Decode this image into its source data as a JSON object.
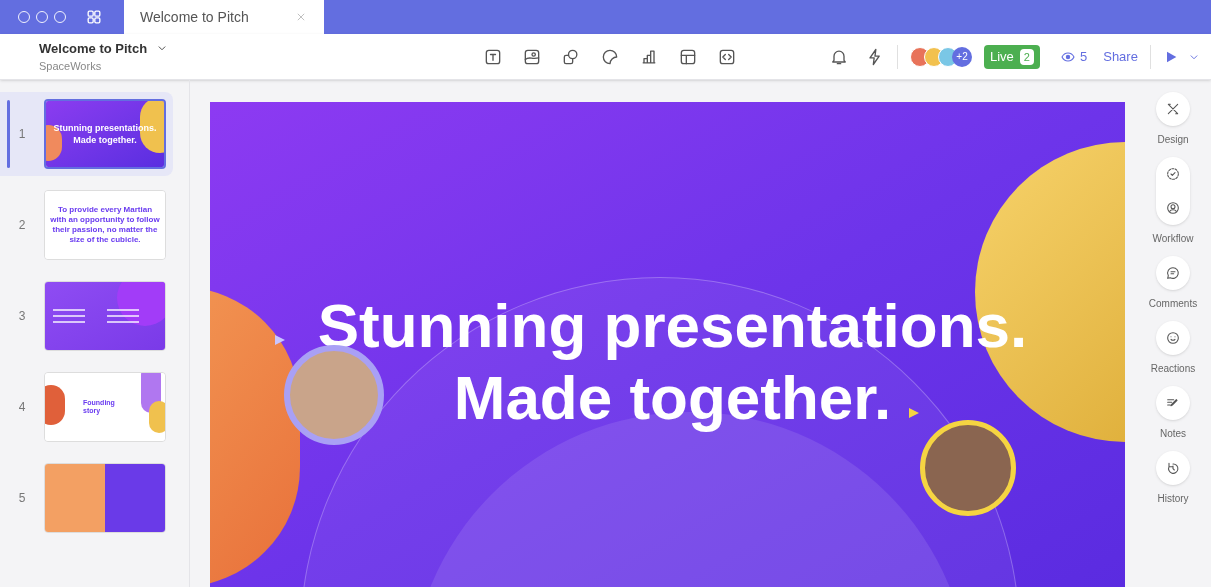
{
  "window": {
    "tab_title": "Welcome to Pitch"
  },
  "header": {
    "title": "Welcome to Pitch",
    "workspace": "SpaceWorks",
    "extra_collaborators": "+2",
    "live": {
      "label": "Live",
      "count": "2"
    },
    "viewers": "5",
    "share": "Share"
  },
  "slides": [
    {
      "number": "1",
      "kind": "cover",
      "selected": true,
      "texts": [
        "Stunning presentations.",
        "Made together."
      ]
    },
    {
      "number": "2",
      "kind": "statement",
      "selected": false,
      "texts": [
        "To provide every Martian with an opportunity to follow their passion, no matter the size of the cubicle."
      ]
    },
    {
      "number": "3",
      "kind": "grid",
      "selected": false
    },
    {
      "number": "4",
      "kind": "story",
      "selected": false,
      "texts": [
        "Founding story"
      ]
    },
    {
      "number": "5",
      "kind": "split",
      "selected": false
    }
  ],
  "canvas": {
    "title_lines": [
      "Stunning presentations.",
      "Made together."
    ]
  },
  "right_rail": [
    {
      "label": "Design",
      "kind": "design"
    },
    {
      "label": "Workflow",
      "kind": "workflow"
    },
    {
      "label": "Comments",
      "kind": "comments"
    },
    {
      "label": "Reactions",
      "kind": "reactions"
    },
    {
      "label": "Notes",
      "kind": "notes"
    },
    {
      "label": "History",
      "kind": "history"
    }
  ]
}
